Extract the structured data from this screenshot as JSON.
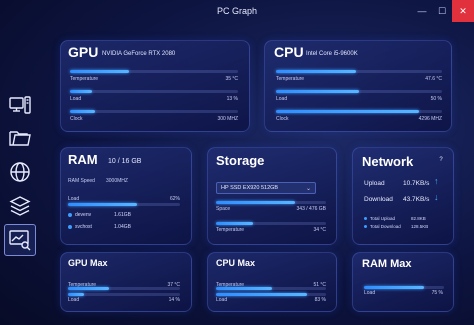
{
  "app": {
    "title": "PC Graph"
  },
  "window_controls": {
    "minimize": "—",
    "maximize": "☐",
    "close": "✕"
  },
  "sidebar": {
    "items": [
      {
        "name": "computer-icon"
      },
      {
        "name": "folder-icon"
      },
      {
        "name": "globe-icon"
      },
      {
        "name": "layers-icon"
      },
      {
        "name": "monitor-search-icon",
        "active": true
      }
    ]
  },
  "gpu": {
    "title": "GPU",
    "model": "NVIDIA GeForce RTX 2080",
    "stats": [
      {
        "label": "Temperature",
        "value": "35 °C",
        "level": 0.35
      },
      {
        "label": "Load",
        "value": "13 %",
        "level": 0.13
      },
      {
        "label": "Clock",
        "value": "300 MHZ",
        "level": 0.15
      }
    ]
  },
  "cpu": {
    "title": "CPU",
    "model": "Intel Core i5-9600K",
    "stats": [
      {
        "label": "Temperature",
        "value": "47.6 °C",
        "level": 0.48
      },
      {
        "label": "Load",
        "value": "50 %",
        "level": 0.5
      },
      {
        "label": "Clock",
        "value": "4296 MHZ",
        "level": 0.86
      }
    ]
  },
  "ram": {
    "title": "RAM",
    "usage": "10 / 16 GB",
    "speed_label": "RAM Speed",
    "speed_value": "3000MHZ",
    "load_label": "Load",
    "load_value": "62%",
    "load_level": 0.62,
    "processes": [
      {
        "name": "devenv",
        "value": "1.61GB"
      },
      {
        "name": "svchost",
        "value": "1.04GB"
      }
    ]
  },
  "storage": {
    "title": "Storage",
    "selected_drive": "HP SSD EX920 512GB",
    "space_label": "Space",
    "space_value": "343 / 476 GB",
    "space_level": 0.72,
    "temp_label": "Temperature",
    "temp_value": "34 °C",
    "temp_level": 0.34
  },
  "network": {
    "title": "Network",
    "help": "?",
    "upload_label": "Upload",
    "upload_value": "10.7KB/s",
    "download_label": "Download",
    "download_value": "43.7KB/s",
    "total_upload_label": "Total Upload",
    "total_upload_value": "82.8KB",
    "total_download_label": "Total Download",
    "total_download_value": "128.5KB"
  },
  "gpu_max": {
    "title": "GPU Max",
    "temp_label": "Temperature",
    "temp_value": "37 °C",
    "temp_level": 0.37,
    "load_label": "Load",
    "load_value": "14 %",
    "load_level": 0.14
  },
  "cpu_max": {
    "title": "CPU Max",
    "temp_label": "Temperature",
    "temp_value": "51 °C",
    "temp_level": 0.51,
    "load_label": "Load",
    "load_value": "83 %",
    "load_level": 0.83
  },
  "ram_max": {
    "title": "RAM Max",
    "load_label": "Load",
    "load_value": "75 %",
    "load_level": 0.75
  },
  "colors": {
    "accent": "#3d9cff",
    "close": "#e0313c",
    "card_border": "#5f78e6"
  }
}
